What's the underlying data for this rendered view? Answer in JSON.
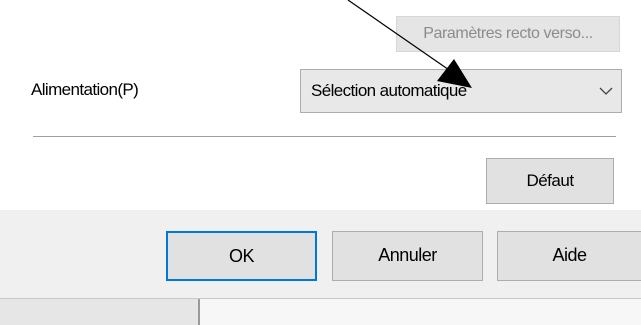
{
  "dialog": {
    "duplex_settings_label": "Paramètres recto verso...",
    "paper_source_label": "Alimentation(P)",
    "paper_source_value": "Sélection automatique",
    "default_label": "Défaut",
    "ok_label": "OK",
    "cancel_label": "Annuler",
    "help_label": "Aide"
  },
  "icons": {
    "dropdown": "chevron-down-icon",
    "annotation": "arrow-pointer-icon"
  },
  "colors": {
    "focus_border": "#0078d7",
    "footer_bg": "#f0f0f0",
    "disabled_text": "#8c8c8c"
  }
}
